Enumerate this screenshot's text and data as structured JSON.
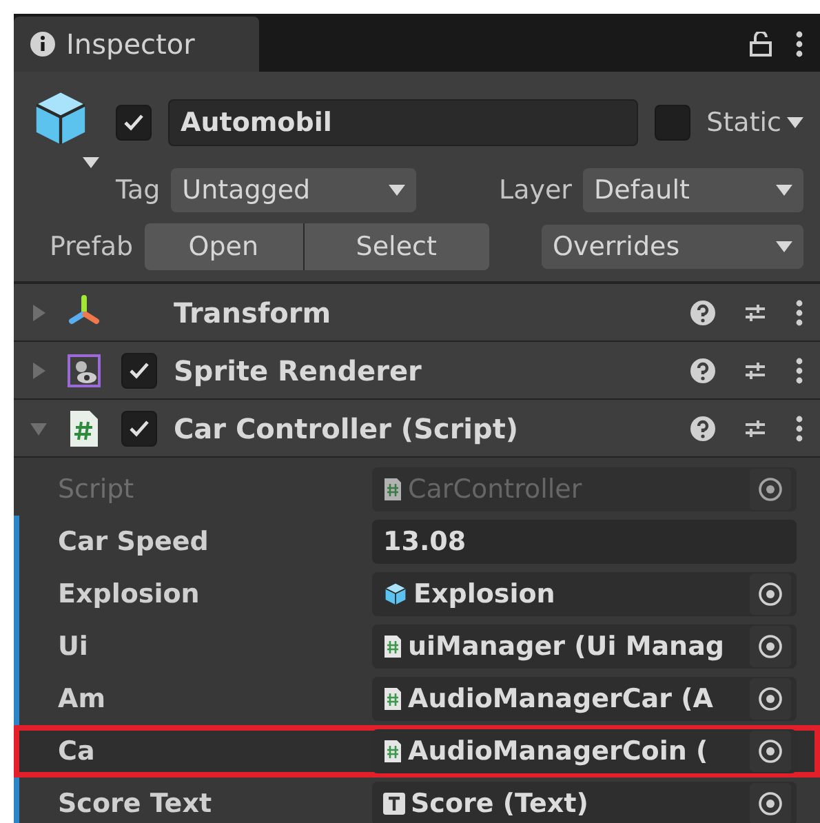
{
  "tab": {
    "title": "Inspector"
  },
  "object": {
    "active": true,
    "name": "Automobil",
    "static": false,
    "static_label": "Static",
    "tag_label": "Tag",
    "tag": "Untagged",
    "layer_label": "Layer",
    "layer": "Default",
    "prefab_label": "Prefab",
    "open": "Open",
    "select": "Select",
    "overrides": "Overrides"
  },
  "components": [
    {
      "name": "Transform",
      "kind": "transform",
      "expanded": false
    },
    {
      "name": "Sprite Renderer",
      "kind": "sprite",
      "expanded": false,
      "enabled": true
    },
    {
      "name": "Car Controller (Script)",
      "kind": "script",
      "expanded": true,
      "enabled": true
    }
  ],
  "fields": [
    {
      "label": "Script",
      "kind": "script",
      "value": "CarController",
      "disabled": true,
      "modified": false,
      "highlighted": false
    },
    {
      "label": "Car Speed",
      "kind": "number",
      "value": "13.08",
      "disabled": false,
      "modified": true,
      "highlighted": false
    },
    {
      "label": "Explosion",
      "kind": "prefab",
      "value": "Explosion",
      "disabled": false,
      "modified": true,
      "highlighted": false
    },
    {
      "label": "Ui",
      "kind": "script",
      "value": "uiManager (Ui Manag",
      "disabled": false,
      "modified": true,
      "highlighted": false
    },
    {
      "label": "Am",
      "kind": "script",
      "value": "AudioManagerCar (A",
      "disabled": false,
      "modified": true,
      "highlighted": false
    },
    {
      "label": "Ca",
      "kind": "script",
      "value": "AudioManagerCoin (",
      "disabled": false,
      "modified": true,
      "highlighted": true
    },
    {
      "label": "Score Text",
      "kind": "text",
      "value": "Score (Text)",
      "disabled": false,
      "modified": true,
      "highlighted": false
    }
  ]
}
